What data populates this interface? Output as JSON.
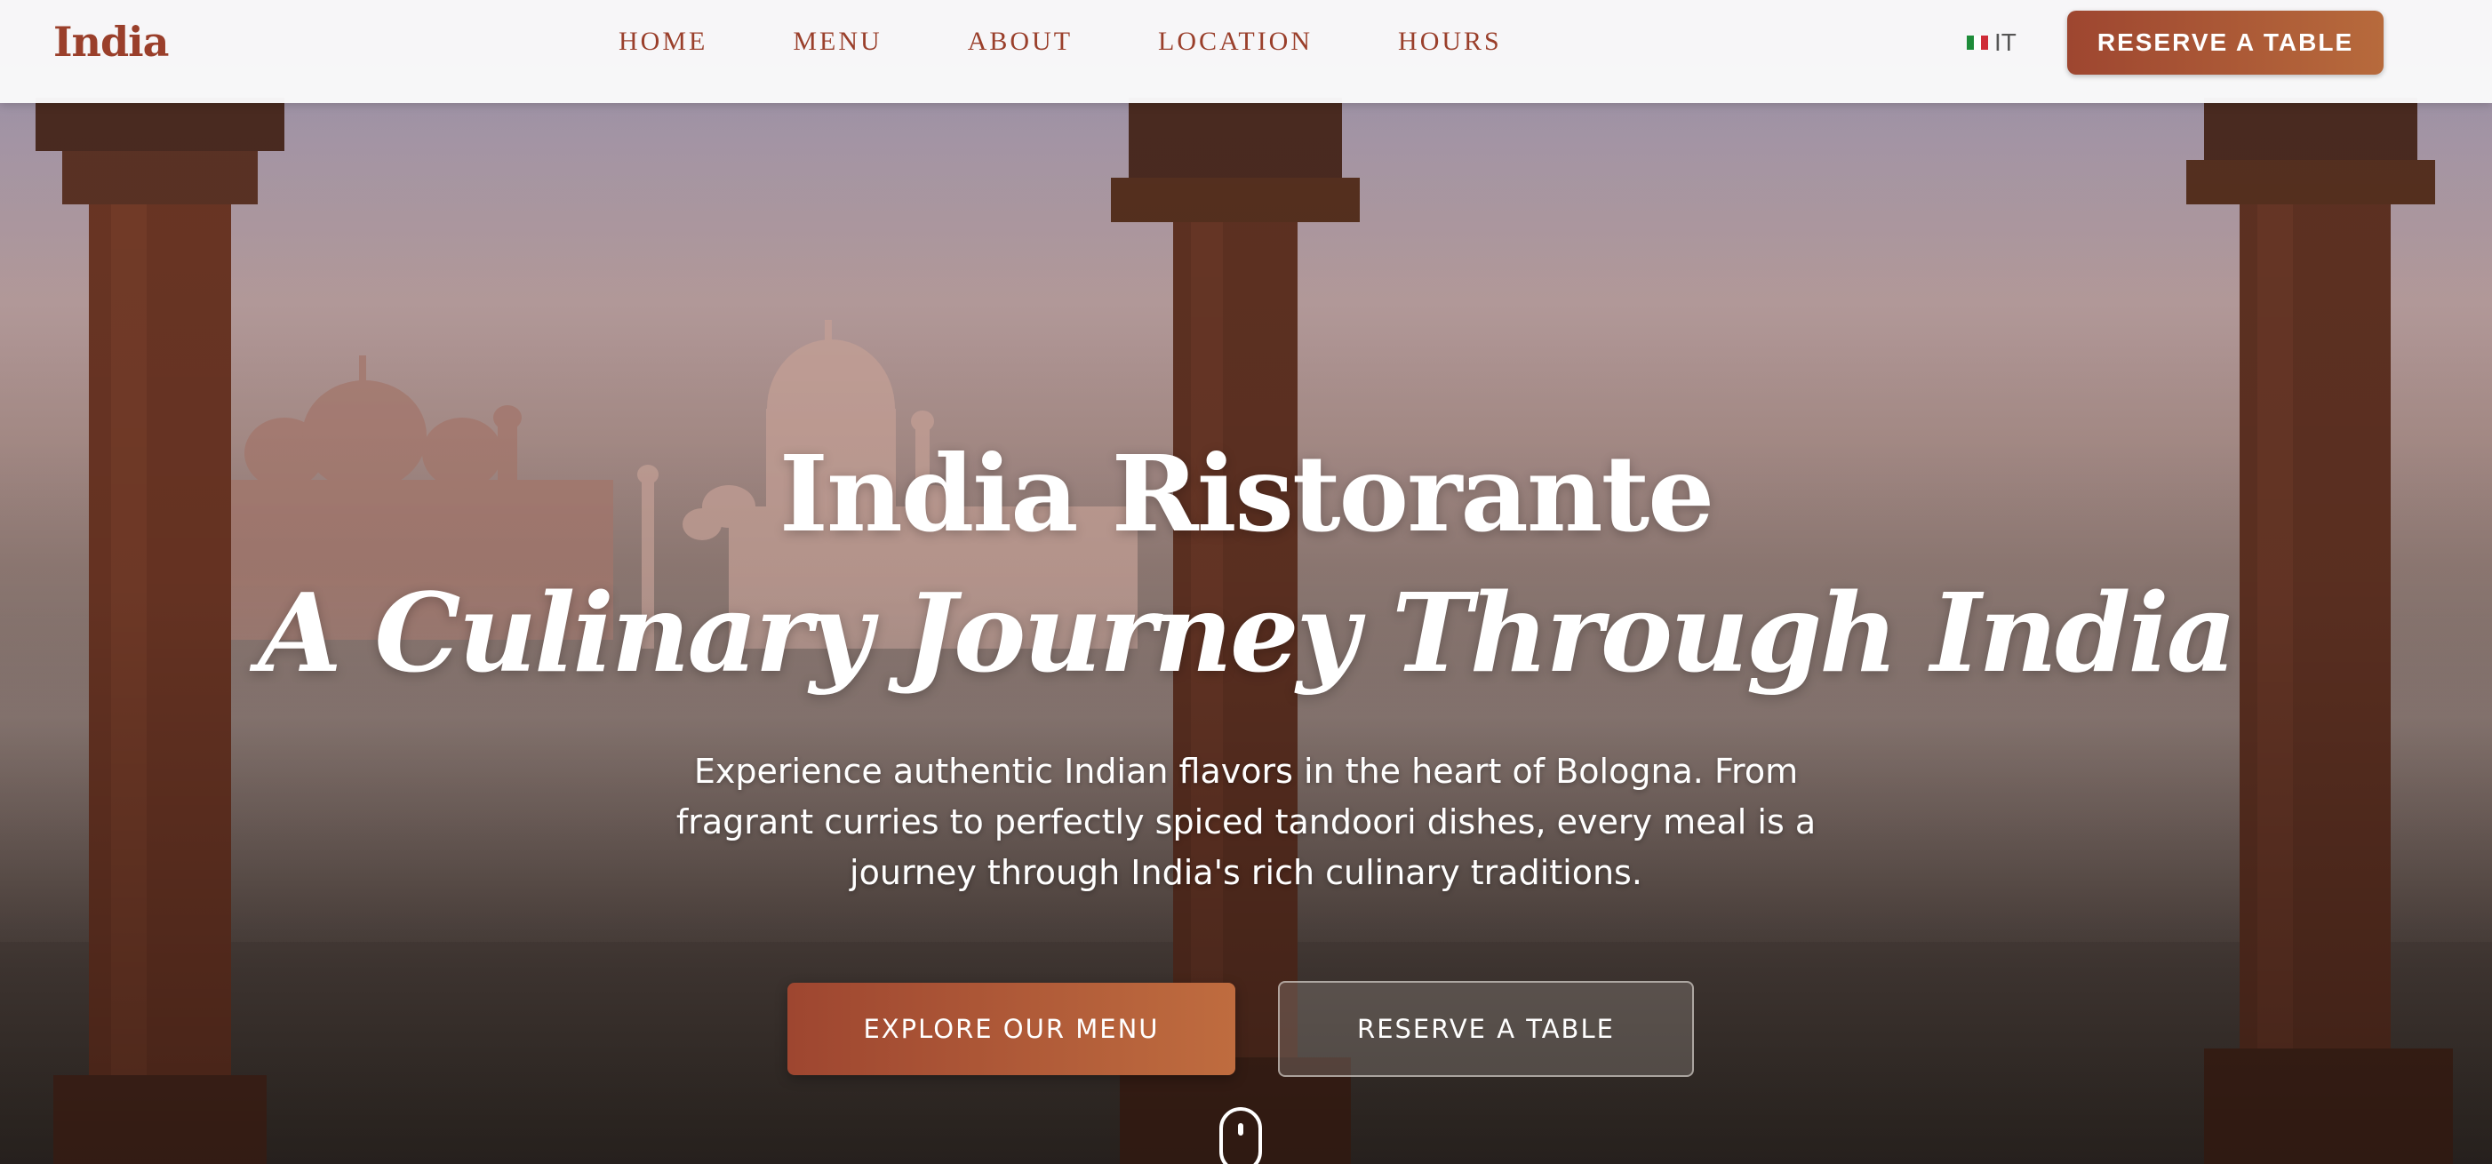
{
  "nav": {
    "brand": "India",
    "links": [
      "HOME",
      "MENU",
      "ABOUT",
      "LOCATION",
      "HOURS"
    ],
    "language": {
      "label": "IT",
      "icon": "italy-flag-icon",
      "flag_colors": [
        "#1e8c3a",
        "#ffffff",
        "#cf2b37"
      ]
    },
    "cta_label": "RESERVE A TABLE"
  },
  "hero": {
    "title": "India Ristorante",
    "subtitle": "A Culinary Journey Through India",
    "description": "Experience authentic Indian flavors in the heart of Bologna. From fragrant curries to perfectly spiced tandoori dishes, every meal is a journey through India's rich culinary traditions.",
    "primary_button": "EXPLORE OUR MENU",
    "secondary_button": "RESERVE A TABLE",
    "scroll_icon": "mouse-scroll-icon"
  },
  "colors": {
    "brand": "#9a3f2b",
    "accent_start": "#9e4630",
    "accent_end": "#bf6c3f"
  }
}
